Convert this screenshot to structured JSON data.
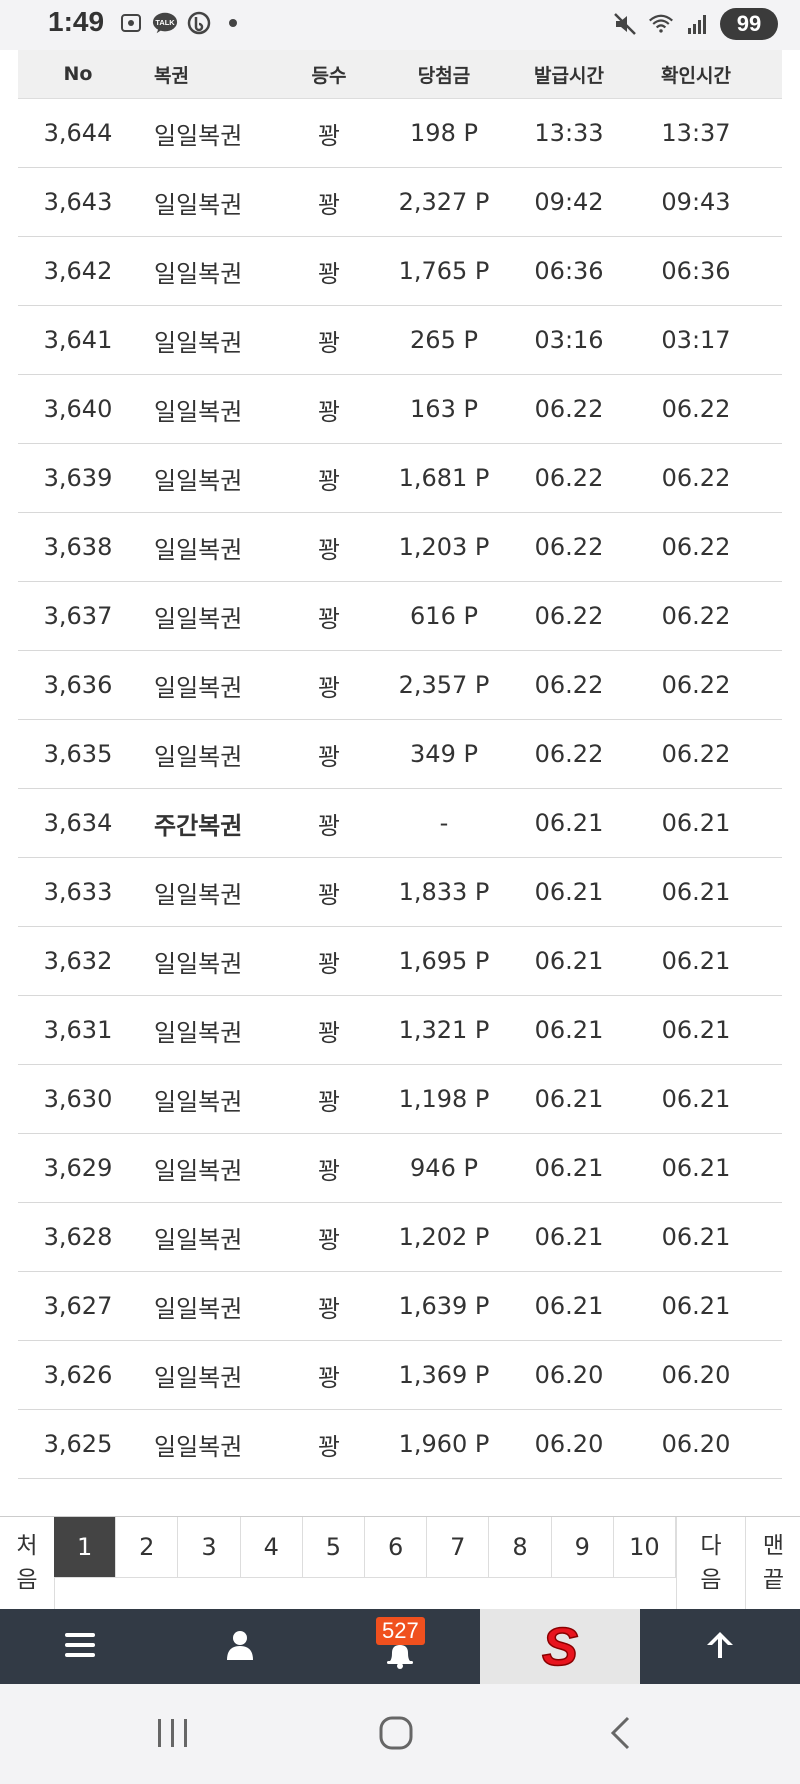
{
  "status": {
    "time": "1:49",
    "battery": "99",
    "talk_label": "TALK"
  },
  "table": {
    "headers": [
      "No",
      "복권",
      "등수",
      "당첨금",
      "발급시간",
      "확인시간"
    ],
    "rows": [
      {
        "no": "3,644",
        "name": "일일복권",
        "rank": "꽝",
        "prize": "198 P",
        "issued": "13:33",
        "checked": "13:37"
      },
      {
        "no": "3,643",
        "name": "일일복권",
        "rank": "꽝",
        "prize": "2,327 P",
        "issued": "09:42",
        "checked": "09:43"
      },
      {
        "no": "3,642",
        "name": "일일복권",
        "rank": "꽝",
        "prize": "1,765 P",
        "issued": "06:36",
        "checked": "06:36"
      },
      {
        "no": "3,641",
        "name": "일일복권",
        "rank": "꽝",
        "prize": "265 P",
        "issued": "03:16",
        "checked": "03:17"
      },
      {
        "no": "3,640",
        "name": "일일복권",
        "rank": "꽝",
        "prize": "163 P",
        "issued": "06.22",
        "checked": "06.22"
      },
      {
        "no": "3,639",
        "name": "일일복권",
        "rank": "꽝",
        "prize": "1,681 P",
        "issued": "06.22",
        "checked": "06.22"
      },
      {
        "no": "3,638",
        "name": "일일복권",
        "rank": "꽝",
        "prize": "1,203 P",
        "issued": "06.22",
        "checked": "06.22"
      },
      {
        "no": "3,637",
        "name": "일일복권",
        "rank": "꽝",
        "prize": "616 P",
        "issued": "06.22",
        "checked": "06.22"
      },
      {
        "no": "3,636",
        "name": "일일복권",
        "rank": "꽝",
        "prize": "2,357 P",
        "issued": "06.22",
        "checked": "06.22"
      },
      {
        "no": "3,635",
        "name": "일일복권",
        "rank": "꽝",
        "prize": "349 P",
        "issued": "06.22",
        "checked": "06.22"
      },
      {
        "no": "3,634",
        "name": "주간복권",
        "rank": "꽝",
        "prize": "-",
        "issued": "06.21",
        "checked": "06.21",
        "bold": true
      },
      {
        "no": "3,633",
        "name": "일일복권",
        "rank": "꽝",
        "prize": "1,833 P",
        "issued": "06.21",
        "checked": "06.21"
      },
      {
        "no": "3,632",
        "name": "일일복권",
        "rank": "꽝",
        "prize": "1,695 P",
        "issued": "06.21",
        "checked": "06.21"
      },
      {
        "no": "3,631",
        "name": "일일복권",
        "rank": "꽝",
        "prize": "1,321 P",
        "issued": "06.21",
        "checked": "06.21"
      },
      {
        "no": "3,630",
        "name": "일일복권",
        "rank": "꽝",
        "prize": "1,198 P",
        "issued": "06.21",
        "checked": "06.21"
      },
      {
        "no": "3,629",
        "name": "일일복권",
        "rank": "꽝",
        "prize": "946 P",
        "issued": "06.21",
        "checked": "06.21"
      },
      {
        "no": "3,628",
        "name": "일일복권",
        "rank": "꽝",
        "prize": "1,202 P",
        "issued": "06.21",
        "checked": "06.21"
      },
      {
        "no": "3,627",
        "name": "일일복권",
        "rank": "꽝",
        "prize": "1,639 P",
        "issued": "06.21",
        "checked": "06.21"
      },
      {
        "no": "3,626",
        "name": "일일복권",
        "rank": "꽝",
        "prize": "1,369 P",
        "issued": "06.20",
        "checked": "06.20"
      },
      {
        "no": "3,625",
        "name": "일일복권",
        "rank": "꽝",
        "prize": "1,960 P",
        "issued": "06.20",
        "checked": "06.20"
      }
    ]
  },
  "pagination": {
    "first_label": "처음",
    "next_label": "다음",
    "last_label": "맨끝",
    "pages": [
      "1",
      "2",
      "3",
      "4",
      "5",
      "6",
      "7",
      "8",
      "9",
      "10"
    ],
    "active_page": "1"
  },
  "appbar": {
    "notification_count": "527",
    "logo_letter": "S",
    "icons": [
      "menu-icon",
      "user-icon",
      "bell-icon",
      "site-logo",
      "arrow-up-icon"
    ]
  },
  "colors": {
    "appbar_bg": "#323a45",
    "badge": "#f0501e",
    "logo_red": "#e8141e",
    "active_page_bg": "#444444"
  }
}
